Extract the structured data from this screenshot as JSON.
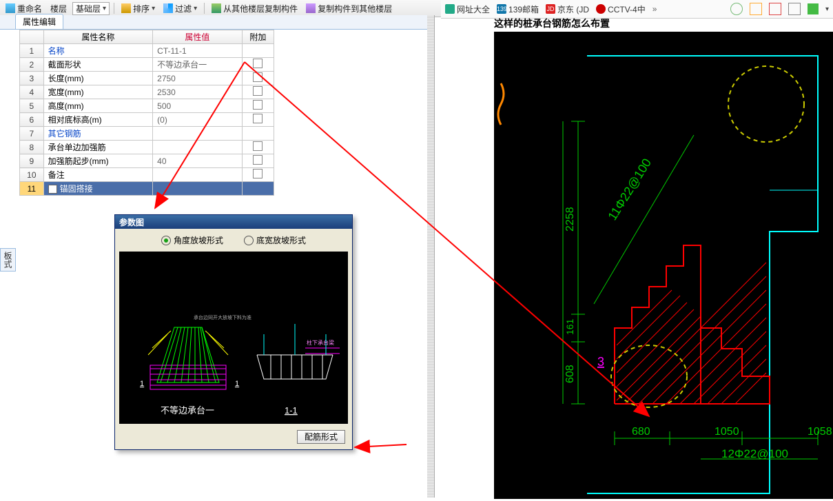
{
  "toolbar": {
    "rename": "重命名",
    "floor": "楼层",
    "basefloor": "基础层",
    "sort": "排序",
    "filter": "过滤",
    "copyfrom": "从其他楼层复制构件",
    "copyto": "复制构件到其他楼层"
  },
  "tab": {
    "label": "属性编辑"
  },
  "headers": {
    "name": "属性名称",
    "value": "属性值",
    "addon": "附加"
  },
  "rows": [
    {
      "n": "1",
      "name": "名称",
      "val": "CT-11-1",
      "blue": true,
      "chk": false
    },
    {
      "n": "2",
      "name": "截面形状",
      "val": "不等边承台一",
      "chk": true
    },
    {
      "n": "3",
      "name": "长度(mm)",
      "val": "2750",
      "chk": true
    },
    {
      "n": "4",
      "name": "宽度(mm)",
      "val": "2530",
      "chk": true
    },
    {
      "n": "5",
      "name": "高度(mm)",
      "val": "500",
      "chk": true
    },
    {
      "n": "6",
      "name": "相对底标高(m)",
      "val": "(0)",
      "chk": true
    },
    {
      "n": "7",
      "name": "其它钢筋",
      "val": "",
      "blue": true,
      "chk": false
    },
    {
      "n": "8",
      "name": "承台单边加强筋",
      "val": "",
      "chk": true
    },
    {
      "n": "9",
      "name": "加强筋起步(mm)",
      "val": "40",
      "chk": true
    },
    {
      "n": "10",
      "name": "备注",
      "val": "",
      "chk": true
    },
    {
      "n": "11",
      "name": "锚固搭接",
      "val": "",
      "sel": true,
      "expand": true
    }
  ],
  "dialog": {
    "title": "参数图",
    "opt1": "角度放坡形式",
    "opt2": "底宽放坡形式",
    "caption1": "不等边承台一",
    "caption2": "1-1",
    "btn": "配筋形式"
  },
  "rightbar": {
    "sites": [
      "网址大全",
      "139邮箱",
      "京东 (JD",
      "CCTV-4中"
    ],
    "more": "»"
  },
  "page": {
    "title": "这样的桩承台钢筋怎么布置"
  },
  "cad": {
    "dim_v1": "2258",
    "dim_v2": "161",
    "dim_v3": "608",
    "mark3": "3",
    "bar_v": "11Φ22@100",
    "dim_h1": "680",
    "dim_h2": "1050",
    "dim_h3": "1058",
    "bar_h": "12Φ22@100"
  },
  "side": {
    "label": "板式"
  }
}
